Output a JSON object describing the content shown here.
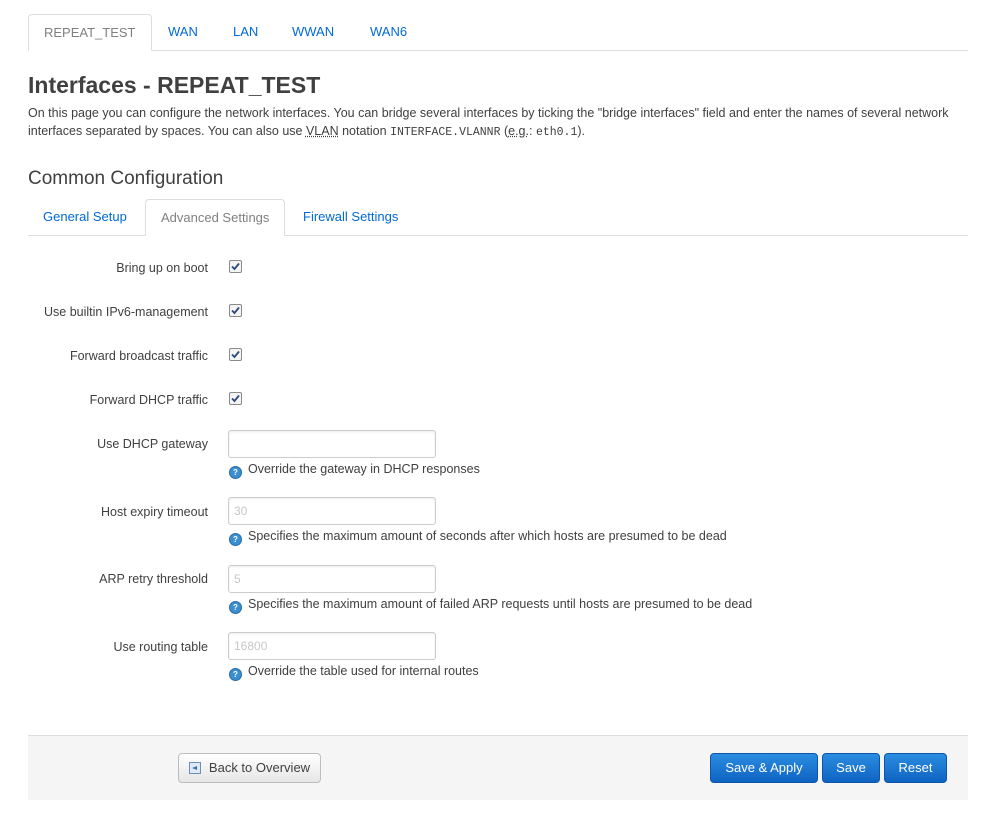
{
  "top_tabs": [
    {
      "label": "REPEAT_TEST",
      "active": true
    },
    {
      "label": "WAN",
      "active": false
    },
    {
      "label": "LAN",
      "active": false
    },
    {
      "label": "WWAN",
      "active": false
    },
    {
      "label": "WAN6",
      "active": false
    }
  ],
  "page": {
    "title": "Interfaces - REPEAT_TEST",
    "description_1": "On this page you can configure the network interfaces. You can bridge several interfaces by ticking the \"bridge interfaces\" field and enter the names of several network interfaces separated by spaces. You can also use ",
    "vlan_abbr": "VLAN",
    "description_2": " notation ",
    "code_1": "INTERFACE.VLANNR",
    "description_3": " (",
    "eg_abbr": "e.g.",
    "description_4": ": ",
    "code_2": "eth0.1",
    "description_5": ")."
  },
  "section": {
    "title": "Common Configuration",
    "tabs": [
      {
        "label": "General Setup",
        "active": false
      },
      {
        "label": "Advanced Settings",
        "active": true
      },
      {
        "label": "Firewall Settings",
        "active": false
      }
    ]
  },
  "form": {
    "bring_up_on_boot": {
      "label": "Bring up on boot",
      "checked": true
    },
    "ipv6_management": {
      "label": "Use builtin IPv6-management",
      "checked": true
    },
    "forward_broadcast": {
      "label": "Forward broadcast traffic",
      "checked": true
    },
    "forward_dhcp": {
      "label": "Forward DHCP traffic",
      "checked": true
    },
    "dhcp_gateway": {
      "label": "Use DHCP gateway",
      "value": "",
      "placeholder": "",
      "help": "Override the gateway in DHCP responses"
    },
    "host_expiry": {
      "label": "Host expiry timeout",
      "value": "",
      "placeholder": "30",
      "help": "Specifies the maximum amount of seconds after which hosts are presumed to be dead"
    },
    "arp_retry": {
      "label": "ARP retry threshold",
      "value": "",
      "placeholder": "5",
      "help": "Specifies the maximum amount of failed ARP requests until hosts are presumed to be dead"
    },
    "routing_table": {
      "label": "Use routing table",
      "value": "",
      "placeholder": "16800",
      "help": "Override the table used for internal routes"
    }
  },
  "actions": {
    "back_label": "Back to Overview",
    "save_apply_label": "Save & Apply",
    "save_label": "Save",
    "reset_label": "Reset"
  },
  "colors": {
    "link": "#0069d6",
    "primary_button": "#1a73d1",
    "help_icon": "#3a8fd0"
  }
}
